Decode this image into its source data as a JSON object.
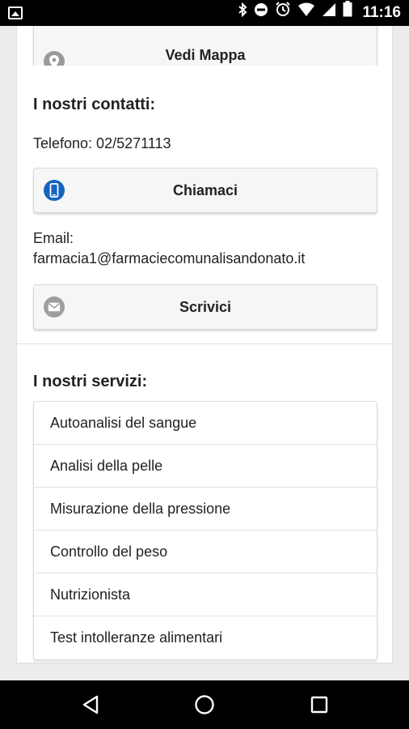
{
  "status_bar": {
    "time": "11:16",
    "icons": [
      "image-icon",
      "bluetooth-icon",
      "do-not-disturb-icon",
      "alarm-icon",
      "wifi-icon",
      "cellular-signal-icon",
      "battery-icon"
    ]
  },
  "map": {
    "button_label": "Vedi Mappa",
    "icon": "map-pin-icon"
  },
  "contacts": {
    "title": "I nostri contatti:",
    "phone_line": "Telefono: 02/5271113",
    "call_button_label": "Chiamaci",
    "call_icon": "phone-icon",
    "email_label": "Email:",
    "email_value": "farmacia1@farmaciecomunalisandonato.it",
    "write_button_label": "Scrivici",
    "write_icon": "mail-icon"
  },
  "services": {
    "title": "I nostri servizi:",
    "items": [
      "Autoanalisi del sangue",
      "Analisi della pelle",
      "Misurazione della pressione",
      "Controllo del peso",
      "Nutrizionista",
      "Test intolleranze alimentari"
    ]
  },
  "nav_bar": {
    "buttons": [
      "back-icon",
      "home-icon",
      "recents-icon"
    ]
  },
  "colors": {
    "call_icon_bg": "#1565c0",
    "neutral_icon_bg": "#9e9e9e",
    "page_bg": "#ececec"
  }
}
